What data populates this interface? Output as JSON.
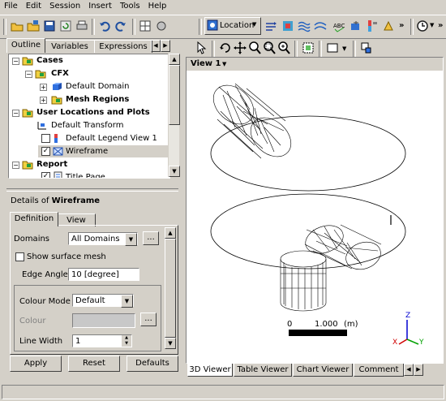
{
  "menu": [
    "File",
    "Edit",
    "Session",
    "Insert",
    "Tools",
    "Help"
  ],
  "toolbar": {
    "location_label": "Location"
  },
  "outline_tabs": [
    "Outline",
    "Variables",
    "Expressions"
  ],
  "tree": [
    {
      "label": "Cases",
      "bold": true
    },
    {
      "label": "CFX",
      "bold": true
    },
    {
      "label": "Default Domain",
      "bold": false
    },
    {
      "label": "Mesh Regions",
      "bold": true
    },
    {
      "label": "User Locations and Plots",
      "bold": true
    },
    {
      "label": "Default Transform",
      "bold": false
    },
    {
      "label": "Default Legend View 1",
      "bold": false
    },
    {
      "label": "Wireframe",
      "bold": false
    },
    {
      "label": "Report",
      "bold": true
    },
    {
      "label": "Title Page",
      "bold": false
    }
  ],
  "details": {
    "prefix": "Details of ",
    "object": "Wireframe",
    "tabs": [
      "Definition",
      "View"
    ],
    "domains_label": "Domains",
    "domains_value": "All Domains",
    "show_surface_mesh": "Show surface mesh",
    "edge_angle_label": "Edge Angle",
    "edge_angle_value": "10 [degree]",
    "colour_mode_label": "Colour Mode",
    "colour_mode_value": "Default",
    "colour_label": "Colour",
    "line_width_label": "Line Width",
    "line_width_value": "1",
    "ellipsis": "..."
  },
  "buttons": {
    "apply": "Apply",
    "reset": "Reset",
    "defaults": "Defaults"
  },
  "viewer": {
    "view_label": "View 1",
    "scale_zero": "0",
    "scale_value": "1.000",
    "scale_unit": "(m)",
    "axis_x": "X",
    "axis_y": "Y",
    "axis_z": "Z"
  },
  "viewer_tabs": [
    "3D Viewer",
    "Table Viewer",
    "Chart Viewer",
    "Comment Vi"
  ],
  "icons": [
    "open-folder-icon",
    "save-icon",
    "undo-icon",
    "redo-icon",
    "location-icon",
    "clock-icon"
  ]
}
